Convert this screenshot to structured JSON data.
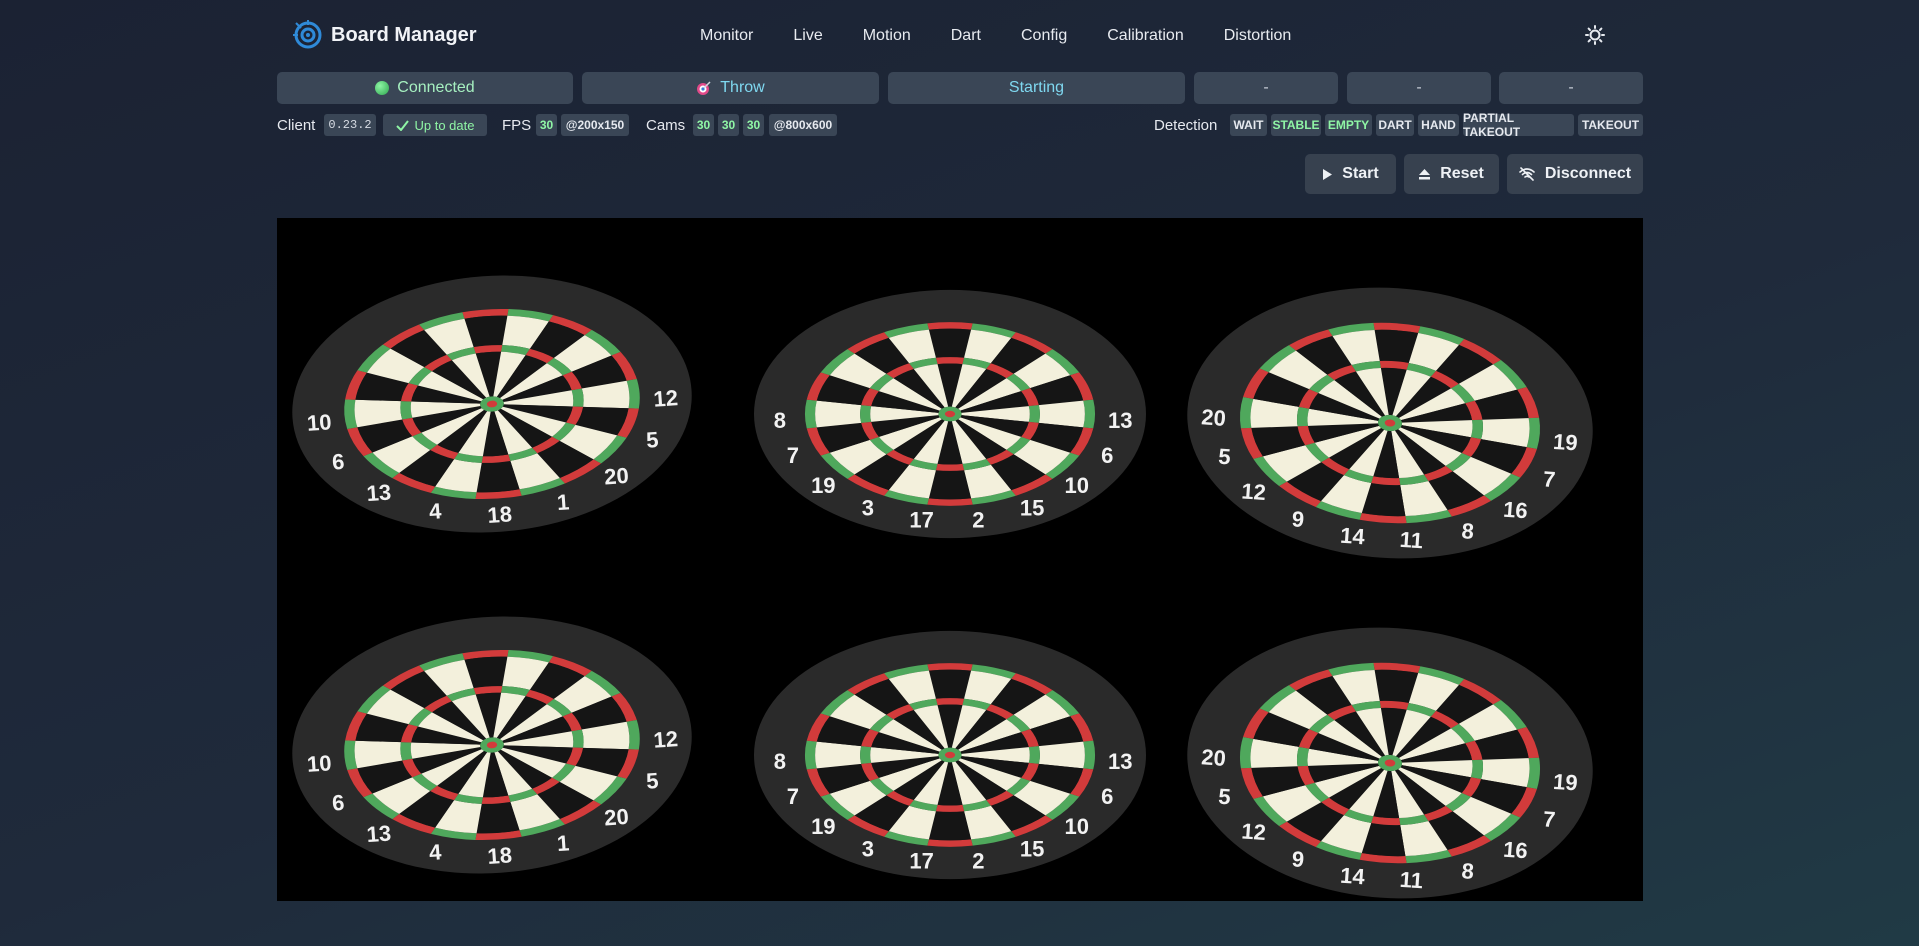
{
  "app": {
    "title": "Board Manager",
    "logo_icon": "target-logo-icon",
    "accent": "#2f8ad8"
  },
  "nav": {
    "items": [
      "Monitor",
      "Live",
      "Motion",
      "Dart",
      "Config",
      "Calibration",
      "Distortion"
    ],
    "theme_icon": "sun-icon"
  },
  "status": {
    "connection": "Connected",
    "mode": "Throw",
    "state": "Starting",
    "slots": [
      "-",
      "-",
      "-"
    ]
  },
  "client": {
    "label": "Client",
    "version": "0.23.2",
    "update_status": "Up to date"
  },
  "fps": {
    "label": "FPS",
    "value": "30",
    "resolution": "@200x150"
  },
  "cams": {
    "label": "Cams",
    "values": [
      "30",
      "30",
      "30"
    ],
    "resolution": "@800x600"
  },
  "detection": {
    "label": "Detection",
    "states": [
      "WAIT",
      "STABLE",
      "EMPTY",
      "DART",
      "HAND",
      "PARTIAL TAKEOUT",
      "TAKEOUT"
    ],
    "active": [
      "STABLE",
      "EMPTY"
    ]
  },
  "actions": {
    "start": "Start",
    "reset": "Reset",
    "disconnect": "Disconnect"
  },
  "camera_feed": {
    "views": [
      {
        "numbers": [
          "10",
          "6",
          "13",
          "4",
          "18",
          "1",
          "20",
          "5",
          "12"
        ]
      },
      {
        "numbers": [
          "8",
          "7",
          "19",
          "3",
          "17",
          "2",
          "15",
          "10",
          "6",
          "13"
        ]
      },
      {
        "numbers": [
          "20",
          "5",
          "12",
          "9",
          "14",
          "11",
          "8",
          "16",
          "7",
          "19"
        ]
      },
      {
        "numbers": [
          "10",
          "6",
          "13",
          "4",
          "18",
          "1",
          "20",
          "5",
          "12"
        ]
      },
      {
        "numbers": [
          "8",
          "7",
          "19",
          "3",
          "17",
          "2",
          "15",
          "10",
          "6",
          "13"
        ]
      },
      {
        "numbers": [
          "20",
          "5",
          "12",
          "9",
          "14",
          "11",
          "8",
          "16",
          "7",
          "19"
        ]
      }
    ],
    "colors": {
      "red": "#d23b3b",
      "green": "#4fa85c",
      "cream": "#f3f0dc",
      "black": "#151515",
      "rim": "#2a2a2a"
    }
  }
}
